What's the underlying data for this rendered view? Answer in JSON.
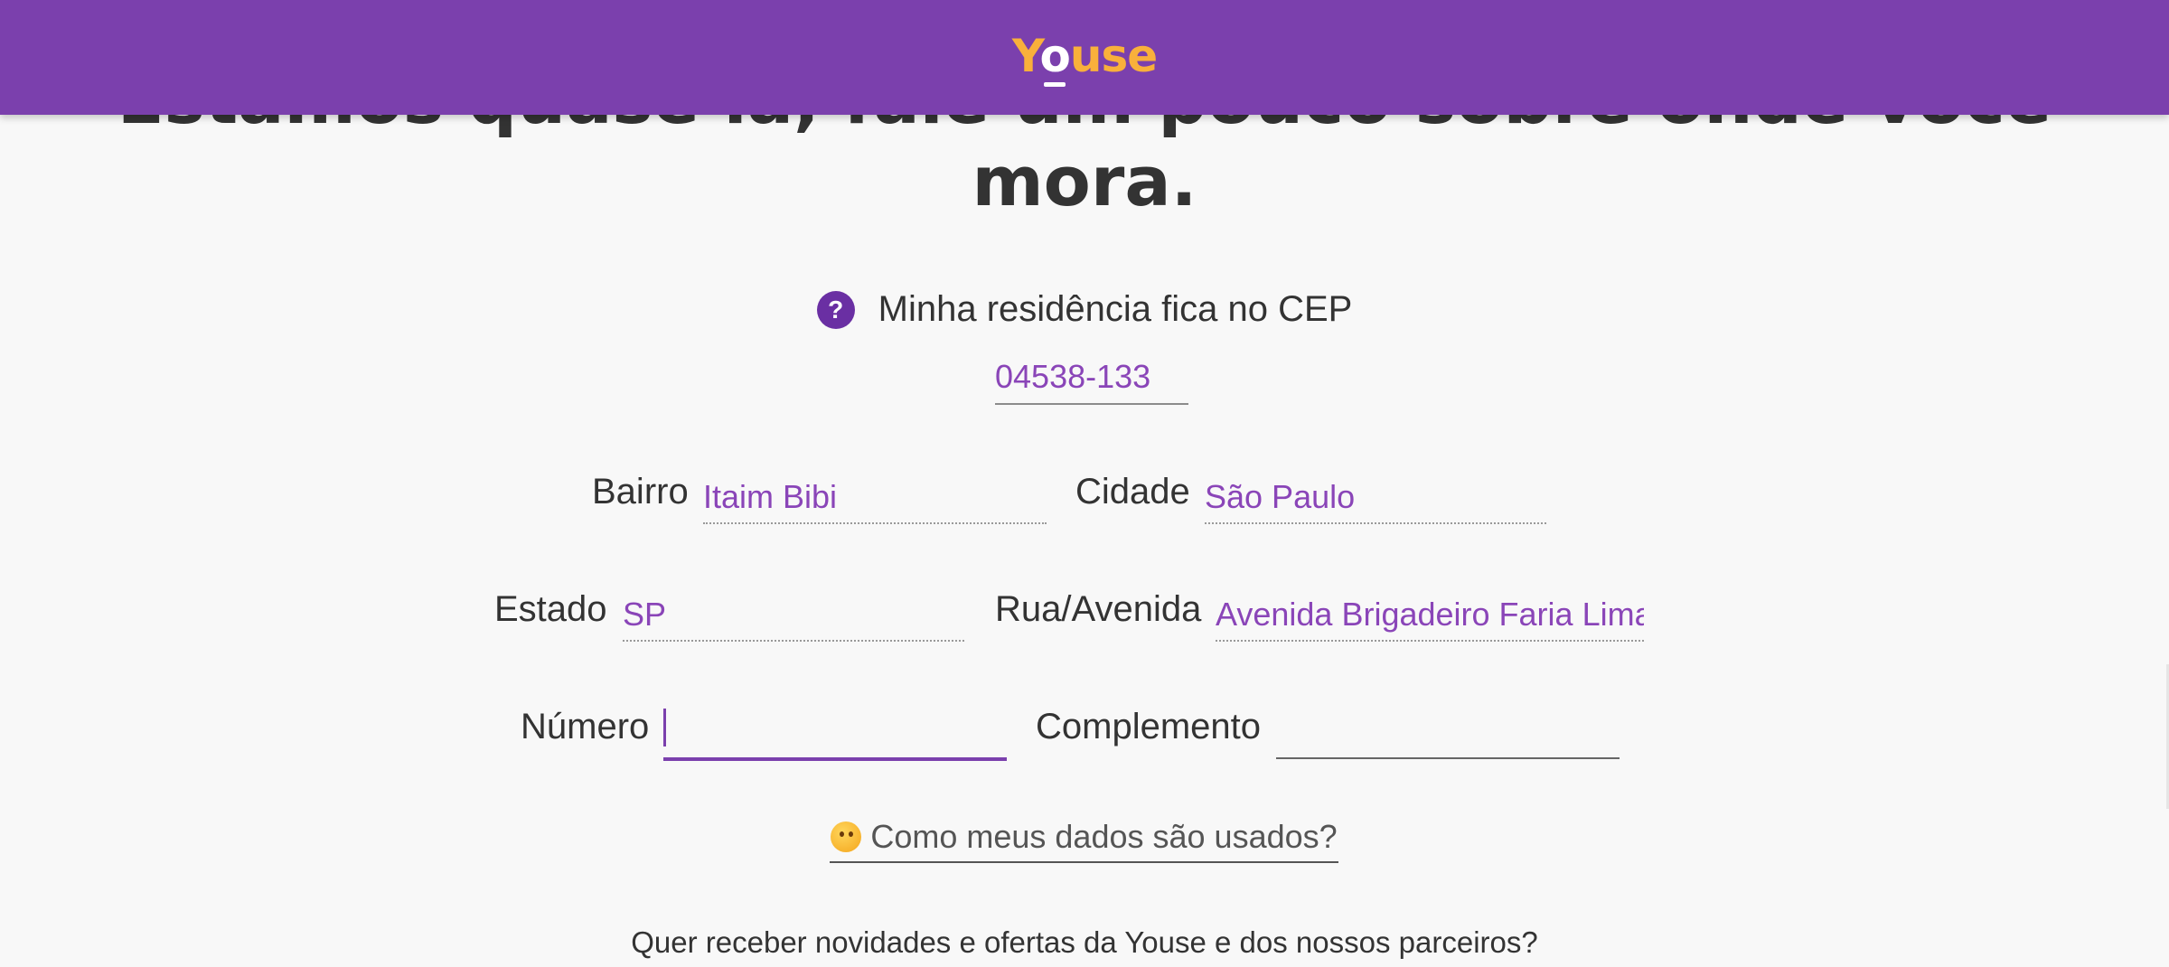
{
  "header": {
    "logo_before": "Y",
    "logo_o": "o",
    "logo_after": "use",
    "background_color": "#7b40ad",
    "logo_color": "#f9b03b"
  },
  "heading": {
    "line1": "Estamos quase lá, fale um pouco sobre onde você",
    "line2": "mora."
  },
  "cep": {
    "help_icon": "question-circle-icon",
    "help_glyph": "?",
    "question": "Minha residência fica no CEP",
    "value": "04538-133"
  },
  "fields": {
    "bairro": {
      "label": "Bairro",
      "value": "Itaim Bibi"
    },
    "cidade": {
      "label": "Cidade",
      "value": "São Paulo"
    },
    "estado": {
      "label": "Estado",
      "value": "SP"
    },
    "rua": {
      "label": "Rua/Avenida",
      "value": "Avenida Brigadeiro Faria Lima"
    },
    "numero": {
      "label": "Número",
      "value": ""
    },
    "complemento": {
      "label": "Complemento",
      "value": ""
    }
  },
  "data_link": {
    "icon": "thinking-face-icon",
    "label": "Como meus dados são usados?"
  },
  "newsletter": {
    "question": "Quer receber novidades e ofertas da Youse e dos nossos parceiros?"
  },
  "colors": {
    "accent": "#7b40ad",
    "input_value": "#8a45b8",
    "text": "#333333"
  }
}
